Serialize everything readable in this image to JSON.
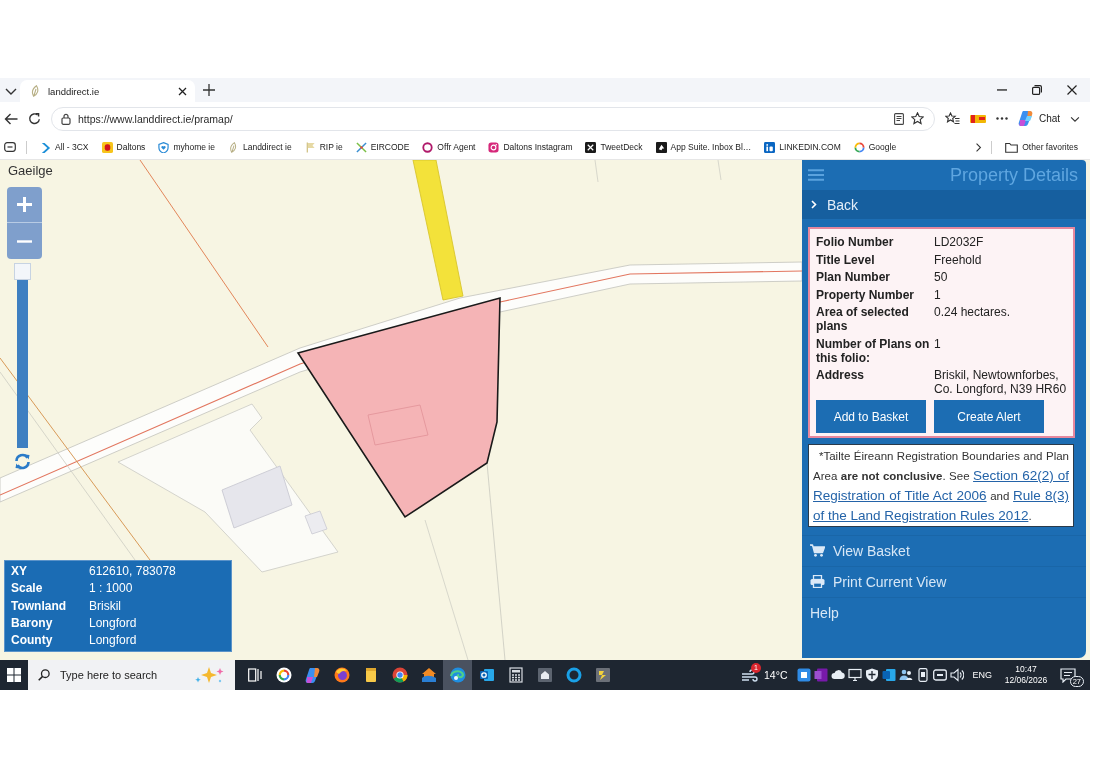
{
  "browser": {
    "tabs": [
      {
        "title": "landdirect.ie",
        "selected": true
      }
    ],
    "url": "https://www.landdirect.ie/pramap/",
    "chat_label": "Chat",
    "bookmarks": [
      "All - 3CX",
      "Daltons",
      "myhome ie",
      "Landdirect ie",
      "RIP ie",
      "EIRCODE",
      "Offr Agent",
      "Daltons Instagram",
      "TweetDeck",
      "App Suite. Inbox Bl…",
      "LINKEDIN.COM",
      "Google"
    ],
    "other_favorites": "Other favorites"
  },
  "map": {
    "language_link": "Gaeilge",
    "zoom_slider": {
      "level": 1
    },
    "info": [
      {
        "label": "XY",
        "value": "612610, 783078"
      },
      {
        "label": "Scale",
        "value": "1 : 1000"
      },
      {
        "label": "Townland",
        "value": "Briskil"
      },
      {
        "label": "Barony",
        "value": "Longford"
      },
      {
        "label": "County",
        "value": "Longford"
      }
    ]
  },
  "panel": {
    "title": "Property Details",
    "back": "Back",
    "details": [
      {
        "label": "Folio Number",
        "value": "LD2032F"
      },
      {
        "label": "Title Level",
        "value": "Freehold"
      },
      {
        "label": "Plan Number",
        "value": "50"
      },
      {
        "label": "Property Number",
        "value": "1"
      },
      {
        "label": "Area of selected plans",
        "value": "0.24 hectares."
      },
      {
        "label": "Number of Plans on this folio:",
        "value": "1"
      },
      {
        "label": "Address",
        "value": "Briskil, Newtownforbes, Co. Longford, N39 HR60"
      }
    ],
    "actions": [
      "Add to Basket",
      "Create Alert"
    ],
    "disclaimer": [
      {
        "kind": "text",
        "text": "*Tailte Éireann Registration Boundaries and Plan Area **are not conclusive**. See "
      },
      {
        "kind": "link",
        "text": "Section 62(2) of"
      },
      {
        "kind": "link",
        "text": "Registration of Title Act 2006"
      },
      {
        "kind": "text",
        "text": " and "
      },
      {
        "kind": "link",
        "text": "Rule 8(3)"
      },
      {
        "kind": "link",
        "text": "of the Land Registration Rules 2012"
      },
      {
        "kind": "text",
        "text": "."
      }
    ],
    "menu": [
      {
        "label": "View Basket",
        "kind": "basket"
      },
      {
        "label": "Print Current View",
        "kind": "print"
      },
      {
        "label": "Help",
        "kind": "plain"
      }
    ]
  },
  "taskbar": {
    "search_placeholder": "Type here to search",
    "apps": [
      {
        "selected": false
      },
      {
        "selected": false
      },
      {
        "selected": false
      },
      {
        "selected": false
      },
      {
        "selected": false
      },
      {
        "selected": false
      },
      {
        "selected": true
      },
      {
        "selected": false
      },
      {
        "selected": false
      },
      {
        "selected": false
      },
      {
        "selected": false
      },
      {
        "selected": false
      }
    ],
    "weather": {
      "temperature": "14°C",
      "badge": "1"
    },
    "language": "ENG",
    "time": "10:47",
    "date": "12/06/2026",
    "notifications": "27"
  }
}
